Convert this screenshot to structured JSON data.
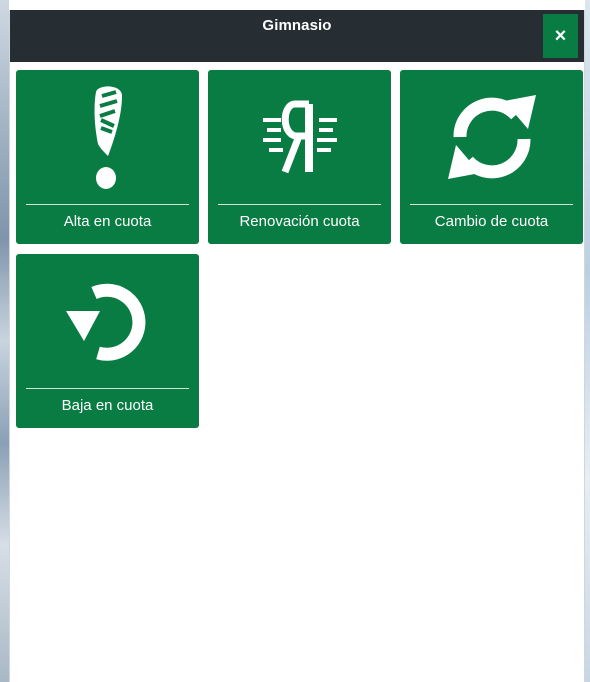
{
  "dialog": {
    "title": "Gimnasio",
    "close_label": "×"
  },
  "tiles": [
    {
      "label": "Alta en cuota",
      "icon": "exclamation-shoe-icon"
    },
    {
      "label": "Renovación cuota",
      "icon": "winged-ya-icon"
    },
    {
      "label": "Cambio de cuota",
      "icon": "refresh-icon"
    },
    {
      "label": "Baja en cuota",
      "icon": "undo-icon"
    }
  ],
  "colors": {
    "tile_green": "#087c42",
    "titlebar": "#262d33",
    "close_green": "#087c42"
  }
}
